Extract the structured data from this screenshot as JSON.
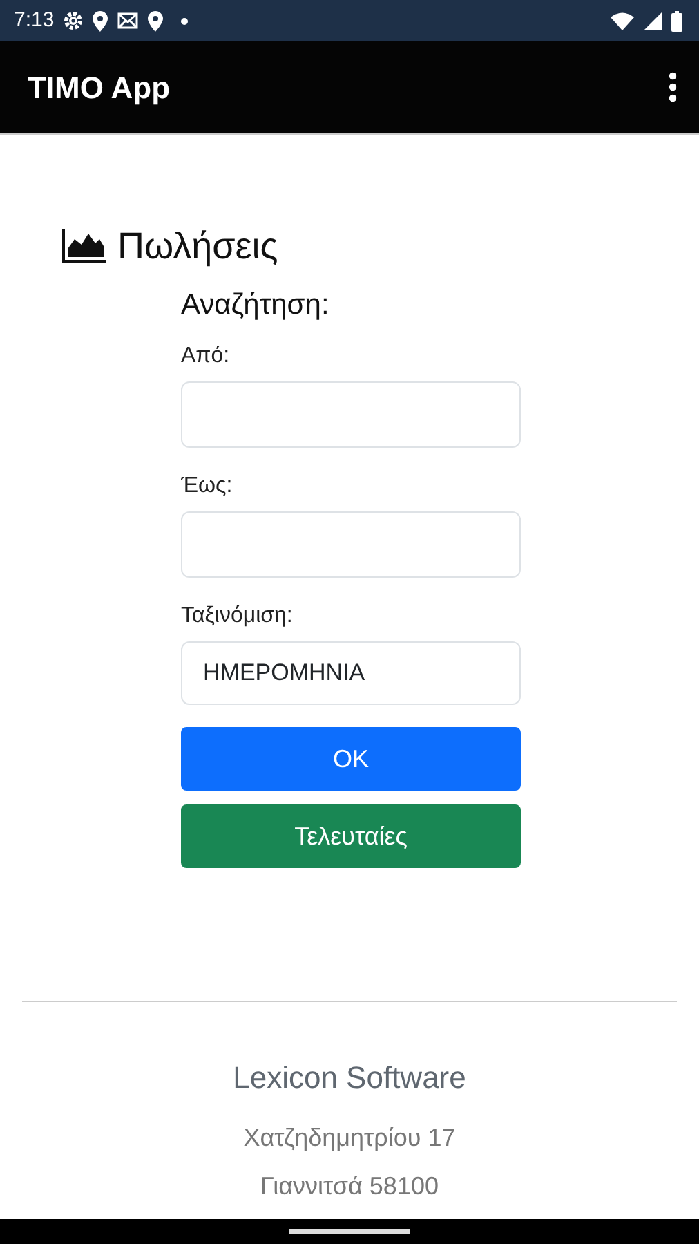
{
  "status_bar": {
    "time": "7:13"
  },
  "app_bar": {
    "title": "TIMO App"
  },
  "page": {
    "title": "Πωλήσεις"
  },
  "search": {
    "heading": "Αναζήτηση:",
    "fields": [
      {
        "label": "Από:"
      },
      {
        "label": "Έως:"
      },
      {
        "label": "Ταξινόμιση:",
        "value": "ΗΜΕΡΟΜΗΝΙΑ"
      }
    ]
  },
  "buttons": [
    {
      "label": "OK",
      "kind": "primary"
    },
    {
      "label": "Τελευταίες",
      "kind": "success"
    }
  ],
  "footer": {
    "company": "Lexicon Software",
    "lines": [
      "Χατζηδημητρίου 17",
      "Γιαννιτσά 58100"
    ]
  }
}
